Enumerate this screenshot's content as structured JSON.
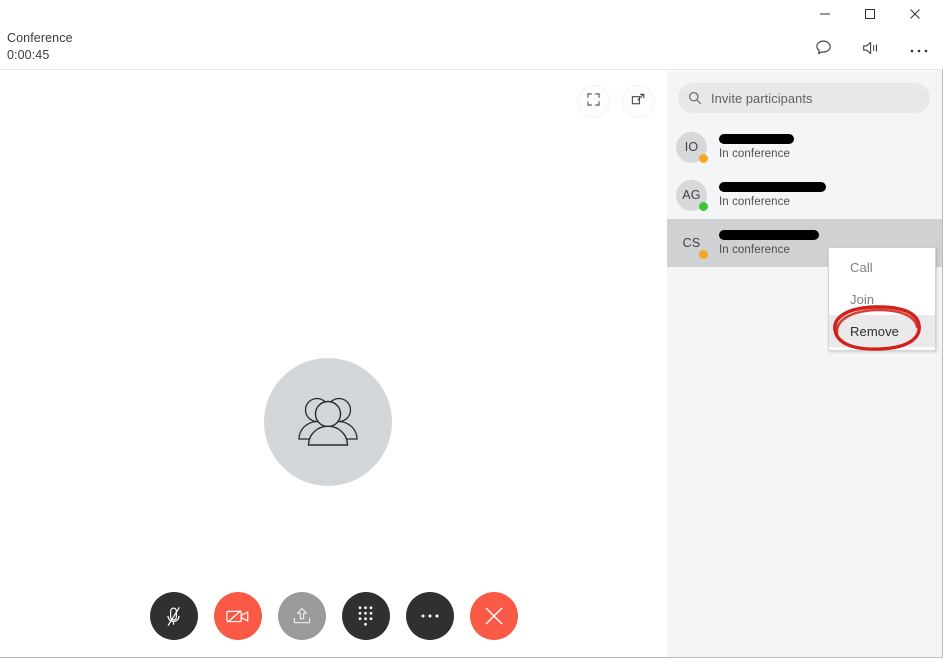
{
  "window": {
    "controls": [
      {
        "name": "minimize",
        "icon": "minimize-icon",
        "label": "Minimize"
      },
      {
        "name": "maximize",
        "icon": "maximize-icon",
        "label": "Maximize"
      },
      {
        "name": "close",
        "icon": "close-icon",
        "label": "Close"
      }
    ]
  },
  "header": {
    "call_title": "Conference",
    "call_timer": "0:00:45",
    "actions": [
      {
        "name": "chat",
        "icon": "chat-bubble-icon",
        "label": "Chat"
      },
      {
        "name": "speaker",
        "icon": "speaker-icon",
        "label": "Speaker"
      },
      {
        "name": "more",
        "icon": "more-horizontal-icon",
        "label": "More"
      }
    ]
  },
  "stage": {
    "tools": [
      {
        "name": "fullscreen",
        "icon": "fullscreen-icon",
        "label": "Full screen"
      },
      {
        "name": "popout",
        "icon": "pop-out-icon",
        "label": "Pop out"
      }
    ],
    "avatar_icon": "group-people-icon"
  },
  "toolbar": {
    "buttons": [
      {
        "name": "microphone",
        "icon": "microphone-muted-icon",
        "label": "Microphone",
        "state": "muted",
        "style": "dark",
        "color": "#2f3031"
      },
      {
        "name": "camera",
        "icon": "camera-off-icon",
        "label": "Camera",
        "state": "off",
        "style": "red",
        "color": "#fa5a45"
      },
      {
        "name": "share-screen",
        "icon": "share-screen-icon",
        "label": "Share screen",
        "state": "disabled",
        "style": "grey",
        "color": "#989a9c"
      },
      {
        "name": "dialpad",
        "icon": "dialpad-icon",
        "label": "Dialpad",
        "state": "default",
        "style": "dark",
        "color": "#2f3031"
      },
      {
        "name": "more-options",
        "icon": "more-horizontal-icon",
        "label": "More options",
        "state": "default",
        "style": "dark",
        "color": "#2f3031"
      },
      {
        "name": "end-call",
        "icon": "end-call-icon",
        "label": "End call",
        "state": "default",
        "style": "red",
        "color": "#fa5a45"
      }
    ]
  },
  "panel": {
    "search": {
      "placeholder": "Invite participants",
      "icon": "search-icon",
      "value": ""
    },
    "participants": [
      {
        "initials": "IO",
        "name_redacted": true,
        "redacted_width": 75,
        "status": "In conference",
        "presence": "away",
        "presence_color": "#f5a623",
        "selected": false
      },
      {
        "initials": "AG",
        "name_redacted": true,
        "redacted_width": 107,
        "status": "In conference",
        "presence": "online",
        "presence_color": "#3cc43c",
        "selected": false
      },
      {
        "initials": "CS",
        "name_redacted": true,
        "redacted_width": 100,
        "status": "In conference",
        "presence": "away",
        "presence_color": "#f5a623",
        "selected": true
      }
    ]
  },
  "context_menu": {
    "items": [
      {
        "label": "Call",
        "enabled": false,
        "highlighted": false
      },
      {
        "label": "Join",
        "enabled": false,
        "highlighted": false
      },
      {
        "label": "Remove",
        "enabled": true,
        "highlighted": true
      }
    ]
  },
  "annotation": {
    "shape": "hand-drawn-ellipse",
    "color": "#d0211c",
    "target": "Remove"
  }
}
